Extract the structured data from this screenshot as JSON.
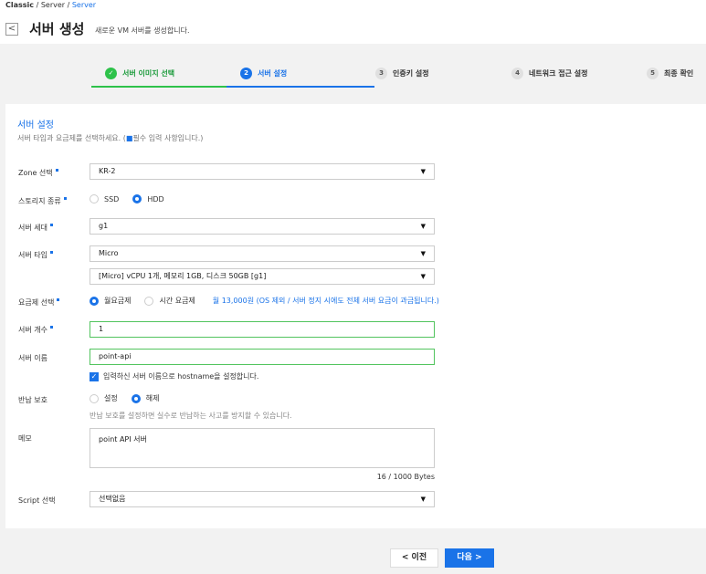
{
  "breadcrumb": {
    "root": "Classic",
    "sep1": " / ",
    "mid": "Server",
    "sep2": " / ",
    "current": "Server"
  },
  "header": {
    "back": "<",
    "title": "서버 생성",
    "subtitle": "새로운 VM 서버를 생성합니다."
  },
  "steps": [
    {
      "num": "✓",
      "label": "서버 이미지 선택",
      "state": "done"
    },
    {
      "num": "2",
      "label": "서버 설정",
      "state": "active"
    },
    {
      "num": "3",
      "label": "인증키 설정",
      "state": "todo"
    },
    {
      "num": "4",
      "label": "네트워크 접근 설정",
      "state": "todo"
    },
    {
      "num": "5",
      "label": "최종 확인",
      "state": "todo"
    }
  ],
  "form": {
    "title": "서버 설정",
    "subtitle_pre": "서버 타입과 요금제를 선택하세요. (",
    "subtitle_mark": "■",
    "subtitle_post": "필수 입력 사항입니다.)",
    "zone": {
      "label": "Zone 선택",
      "value": "KR-2"
    },
    "storage": {
      "label": "스토리지 종류",
      "options": [
        "SSD",
        "HDD"
      ],
      "selected": "HDD"
    },
    "generation": {
      "label": "서버 세대",
      "value": "g1"
    },
    "type": {
      "label": "서버 타입",
      "value": "Micro",
      "spec": "[Micro] vCPU 1개, 메모리 1GB, 디스크 50GB [g1]"
    },
    "billing": {
      "label": "요금제 선택",
      "options": [
        "월요금제",
        "시간 요금제"
      ],
      "selected": "월요금제",
      "note": "월 13,000원 (OS 제외 / 서버 정지 시에도 전체 서버 요금이 과금됩니다.)"
    },
    "count": {
      "label": "서버 개수",
      "value": "1"
    },
    "name": {
      "label": "서버 이름",
      "value": "point-api",
      "hostname_check": "입력하신 서버 이름으로 hostname을 설정합니다."
    },
    "protect": {
      "label": "반납 보호",
      "options": [
        "설정",
        "해제"
      ],
      "selected": "해제",
      "hint": "반납 보호를 설정하면 실수로 반납하는 사고를 방지할 수 있습니다."
    },
    "memo": {
      "label": "메모",
      "value": "point API 서버",
      "counter": "16 / 1000 Bytes"
    },
    "script": {
      "label": "Script 선택",
      "value": "선택없음"
    }
  },
  "footer": {
    "prev": "< 이전",
    "next": "다음 >"
  },
  "colors": {
    "accent": "#1a73e8",
    "success": "#2ec24a"
  },
  "icons": {
    "caret": "caret-down-icon",
    "check": "check-icon"
  }
}
